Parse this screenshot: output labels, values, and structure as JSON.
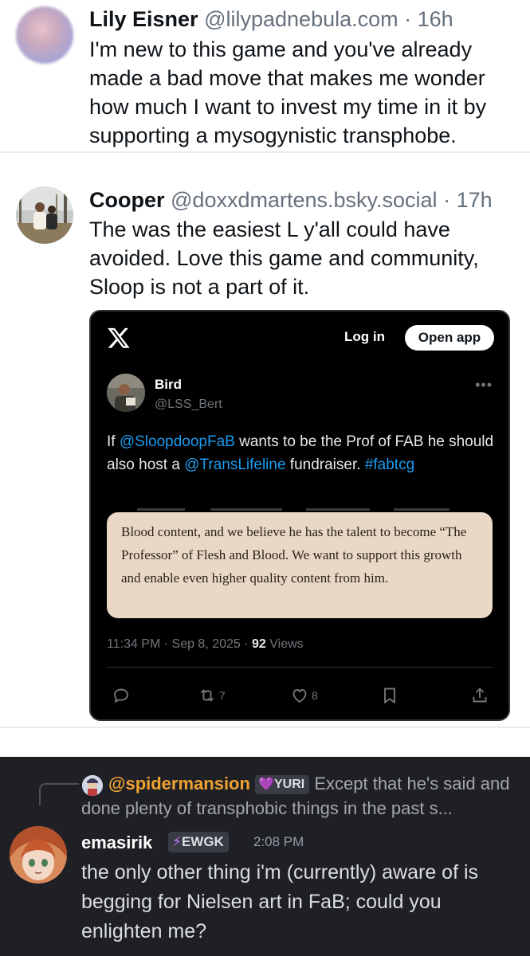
{
  "post1": {
    "author_name": "Lily Eisner",
    "author_handle": "@lilypadnebula.com",
    "time": "· 16h",
    "text": "I'm new to this game and you've already made a bad move that makes me wonder how much I want to invest my time in it by supporting a mysogynistic transphobe."
  },
  "post2": {
    "author_name": "Cooper",
    "author_handle": "@doxxdmartens.bsky.social",
    "time": "· 17h",
    "text": "The was the easiest L y'all could have avoided. Love this game and community, Sloop is not a part of it."
  },
  "embed": {
    "login_label": "Log in",
    "open_app_label": "Open app",
    "author_name": "Bird",
    "author_handle": "@LSS_Bert",
    "text_parts": {
      "p1": "If ",
      "mention1": "@SloopdoopFaB",
      "p2": " wants to be the Prof of FAB he should also host a ",
      "mention2": "@TransLifeline",
      "p3": " fundraiser. ",
      "hashtag": "#fabtcg"
    },
    "quote_text": "Blood content, and we believe he has the talent to become “The Professor” of Flesh and Blood. We want to support this growth and enable even higher quality content from him.",
    "time": "11:34 PM · Sep 8, 2025 · ",
    "views_count": "92",
    "views_label": " Views",
    "retweets": "7",
    "likes": "8"
  },
  "discord": {
    "reply_user": "@spidermansion",
    "reply_tag": "YURI",
    "reply_text": "Except that he's said and done plenty of transphobic things in the past s...",
    "user": "emasirik",
    "tag": "EWGK",
    "time": "2:08 PM",
    "message": "the only other thing i'm (currently) aware of is begging for Nielsen art in FaB; could you enlighten me?"
  },
  "colors": {
    "link": "#1d9bf0",
    "discord_bg": "#1f2025",
    "reply_username": "#f0a232"
  }
}
